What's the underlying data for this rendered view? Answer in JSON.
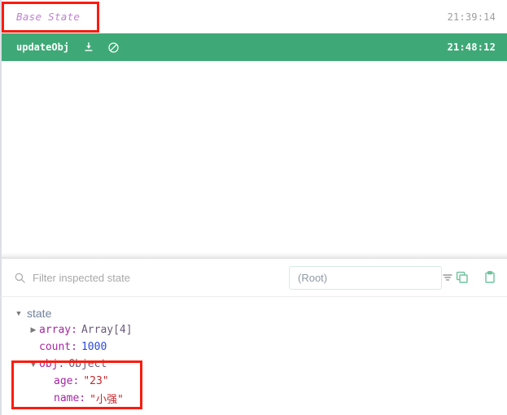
{
  "log": {
    "base_entry": {
      "label": "Base State",
      "time": "21:39:14"
    },
    "active_entry": {
      "label": "updateObj",
      "time": "21:48:12",
      "jump_icon": "download-icon",
      "skip_icon": "circle-slash-icon"
    }
  },
  "toolbar": {
    "search_placeholder": "Filter inspected state",
    "search_value": "",
    "search_icon": "search-icon",
    "path_value": "",
    "path_placeholder": "(Root)",
    "funnel_icon": "funnel-icon",
    "copy_icon": "copy-icon",
    "clipboard_icon": "clipboard-icon"
  },
  "tree": {
    "root": {
      "label": "state",
      "expanded": true
    },
    "nodes": [
      {
        "key": "array:",
        "type": "Array[4]",
        "kind": "type",
        "expanded": false,
        "indent": 1
      },
      {
        "key": "count:",
        "value": "1000",
        "kind": "number",
        "indent": 1
      },
      {
        "key": "obj:",
        "type": "Object",
        "kind": "type",
        "expanded": true,
        "indent": 1
      },
      {
        "key": "age:",
        "value": "\"23\"",
        "kind": "string",
        "indent": 2
      },
      {
        "key": "name:",
        "value": "\"小强\"",
        "kind": "string",
        "indent": 2
      }
    ]
  },
  "colors": {
    "active_row_green": "#3ea977",
    "annotation_red": "#fb1b0f",
    "key_magenta": "#a626a4",
    "number_blue": "#2b4ae0",
    "string_red": "#c7252b",
    "base_label_purple": "#c07fd4",
    "icon_green": "#6cc39b"
  }
}
